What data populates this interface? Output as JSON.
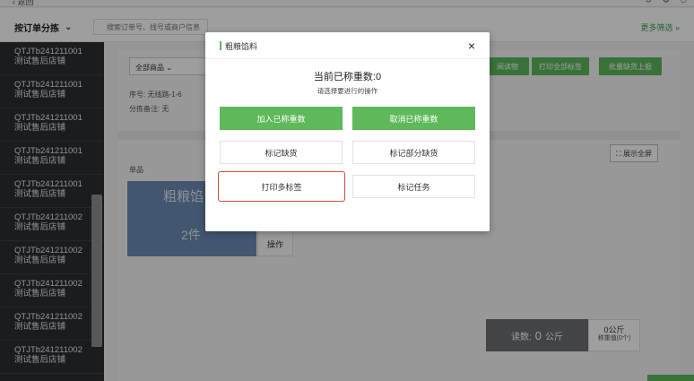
{
  "filter": {
    "sort_label": "按订单分拣",
    "search_placeholder": "搜索订单号、线号或商户信息",
    "more_filter": "更多筛选"
  },
  "sidebar": {
    "orders": [
      {
        "id": "QTJTb241211001",
        "shop": "测试售后店铺"
      },
      {
        "id": "QTJTb241211001",
        "shop": "测试售后店铺"
      },
      {
        "id": "QTJTb241211001",
        "shop": "测试售后店铺"
      },
      {
        "id": "QTJTb241211001",
        "shop": "测试售后店铺"
      },
      {
        "id": "QTJTb241211001",
        "shop": "测试售后店铺"
      },
      {
        "id": "QTJTb241211002",
        "shop": "测试售后店铺"
      },
      {
        "id": "QTJTb241211002",
        "shop": "测试售后店铺"
      },
      {
        "id": "QTJTb241211002",
        "shop": "测试售后店铺"
      },
      {
        "id": "QTJTb241211002",
        "shop": "测试售后店铺"
      },
      {
        "id": "QTJTb241211002",
        "shop": "测试售后店铺"
      }
    ]
  },
  "content": {
    "goods_select": "全部商品",
    "route_info": "序号: 无线路-1-6",
    "remark_info": "分拣备注: 无",
    "buttons": {
      "b1": "阅读物",
      "b2": "打印全部标签",
      "b3": "批量缺货上报"
    },
    "fullscreen": "展示全屏",
    "label_danian": "单品",
    "card_title": "粗粮馅",
    "card_count": "2件",
    "op_label": "操作",
    "weigh_label": "读数:",
    "weigh_value": "0",
    "weigh_unit": "公斤",
    "zero_value": "0公斤",
    "zero_label": "称重值(0个)"
  },
  "modal": {
    "title": "粗粮馅料",
    "tare_title": "当前已称重数:0",
    "tare_hint": "请选择要进行的操作",
    "add_weighed": "加入已称重数",
    "cancel_weighed": "取消已称重数",
    "mark_out_of_stock": "标记缺货",
    "mark_partial_out": "标记部分缺货",
    "print_multi_labels": "打印多标签",
    "mark_task": "标记任务"
  }
}
